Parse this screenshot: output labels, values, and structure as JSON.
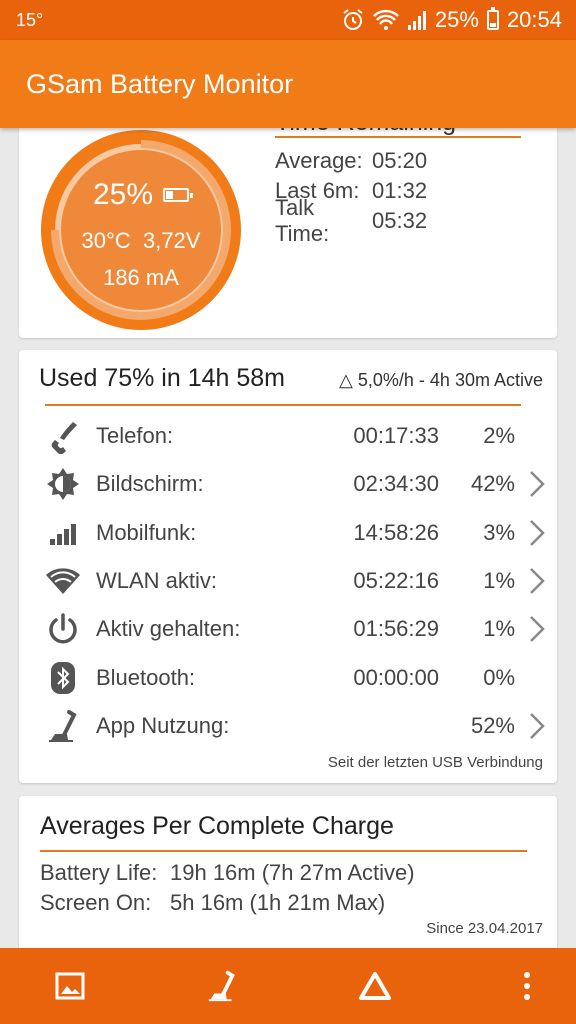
{
  "status": {
    "temperature": "15°",
    "battery": "25%",
    "time": "20:54",
    "icons": [
      "alarm-icon",
      "wifi-icon",
      "signal-icon",
      "battery-icon"
    ]
  },
  "app": {
    "title": "GSam Battery Monitor"
  },
  "gauge": {
    "percent": "25%",
    "level": 0.25,
    "temperature": "30°C",
    "voltage": "3,72V",
    "current": "186 mA",
    "colors": {
      "fill": "#f0883a",
      "ring": "#f5a86c",
      "ring_bg": "#f7c9a0",
      "border": "#f07b17"
    }
  },
  "time_remaining": {
    "title": "Time Remaining",
    "rows": [
      {
        "label": "Average:",
        "value": "05:20"
      },
      {
        "label": "Last 6m:",
        "value": "01:32"
      },
      {
        "label": "Talk Time:",
        "value": "05:32"
      }
    ]
  },
  "usage": {
    "title": "Used 75% in 14h 58m",
    "subtitle": "△ 5,0%/h - 4h 30m Active",
    "items": [
      {
        "icon": "phone-icon",
        "label": "Telefon:",
        "time": "00:17:33",
        "percent": "2%",
        "has_detail": false
      },
      {
        "icon": "brightness-icon",
        "label": "Bildschirm:",
        "time": "02:34:30",
        "percent": "42%",
        "has_detail": true
      },
      {
        "icon": "signal-bars-icon",
        "label": "Mobilfunk:",
        "time": "14:58:26",
        "percent": "3%",
        "has_detail": true
      },
      {
        "icon": "wifi-icon",
        "label": "WLAN aktiv:",
        "time": "05:22:16",
        "percent": "1%",
        "has_detail": true
      },
      {
        "icon": "power-icon",
        "label": "Aktiv gehalten:",
        "time": "01:56:29",
        "percent": "1%",
        "has_detail": true
      },
      {
        "icon": "bluetooth-icon",
        "label": "Bluetooth:",
        "time": "00:00:00",
        "percent": "0%",
        "has_detail": false
      },
      {
        "icon": "app-usage-icon",
        "label": "App Nutzung:",
        "time": "",
        "percent": "52%",
        "has_detail": true
      }
    ],
    "footer": "Seit der letzten USB Verbindung"
  },
  "averages": {
    "title": "Averages Per Complete Charge",
    "rows": [
      {
        "label": "Battery Life:",
        "value": "19h 16m (7h 27m Active)"
      },
      {
        "label": "Screen On:",
        "value": "5h 16m (1h 21m Max)"
      }
    ],
    "footer": "Since 23.04.2017"
  },
  "bottom_bar": {
    "items": [
      "image-icon",
      "app-usage-icon",
      "triangle-icon",
      "more-vert-icon"
    ]
  }
}
